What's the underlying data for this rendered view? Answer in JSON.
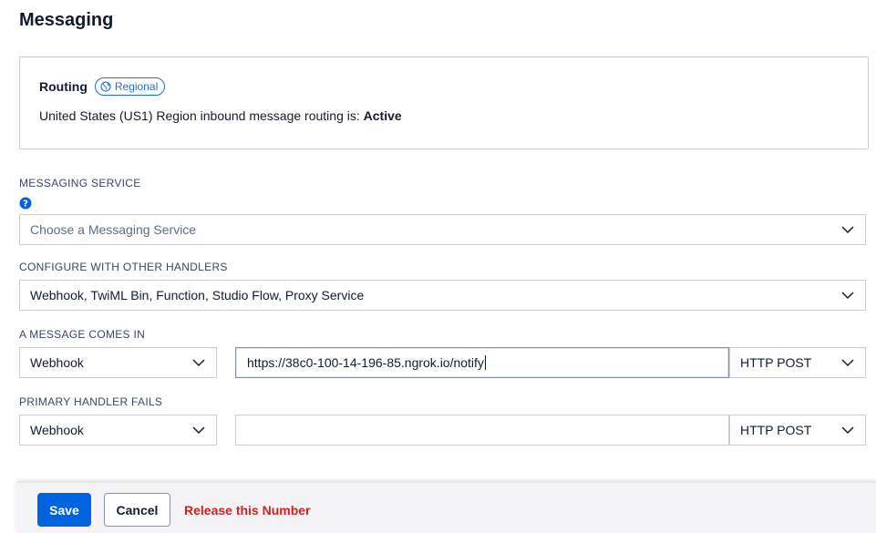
{
  "page": {
    "title": "Messaging"
  },
  "routing": {
    "label": "Routing",
    "badge": "Regional",
    "status_prefix": "United States (US1) Region inbound message routing is: ",
    "status_value": "Active"
  },
  "messaging_service": {
    "label": "MESSAGING SERVICE",
    "placeholder": "Choose a Messaging Service"
  },
  "configure": {
    "label": "CONFIGURE WITH OTHER HANDLERS",
    "value": "Webhook, TwiML Bin, Function, Studio Flow, Proxy Service"
  },
  "message_comes_in": {
    "label": "A MESSAGE COMES IN",
    "type": "Webhook",
    "url": "https://38c0-100-14-196-85.ngrok.io/notify",
    "method": "HTTP POST"
  },
  "primary_fails": {
    "label": "PRIMARY HANDLER FAILS",
    "type": "Webhook",
    "url": "",
    "method": "HTTP POST"
  },
  "footer": {
    "save": "Save",
    "cancel": "Cancel",
    "release": "Release this Number"
  },
  "colors": {
    "primary": "#0263e0",
    "danger": "#d61f1f",
    "badge": "#1f6fd6"
  }
}
